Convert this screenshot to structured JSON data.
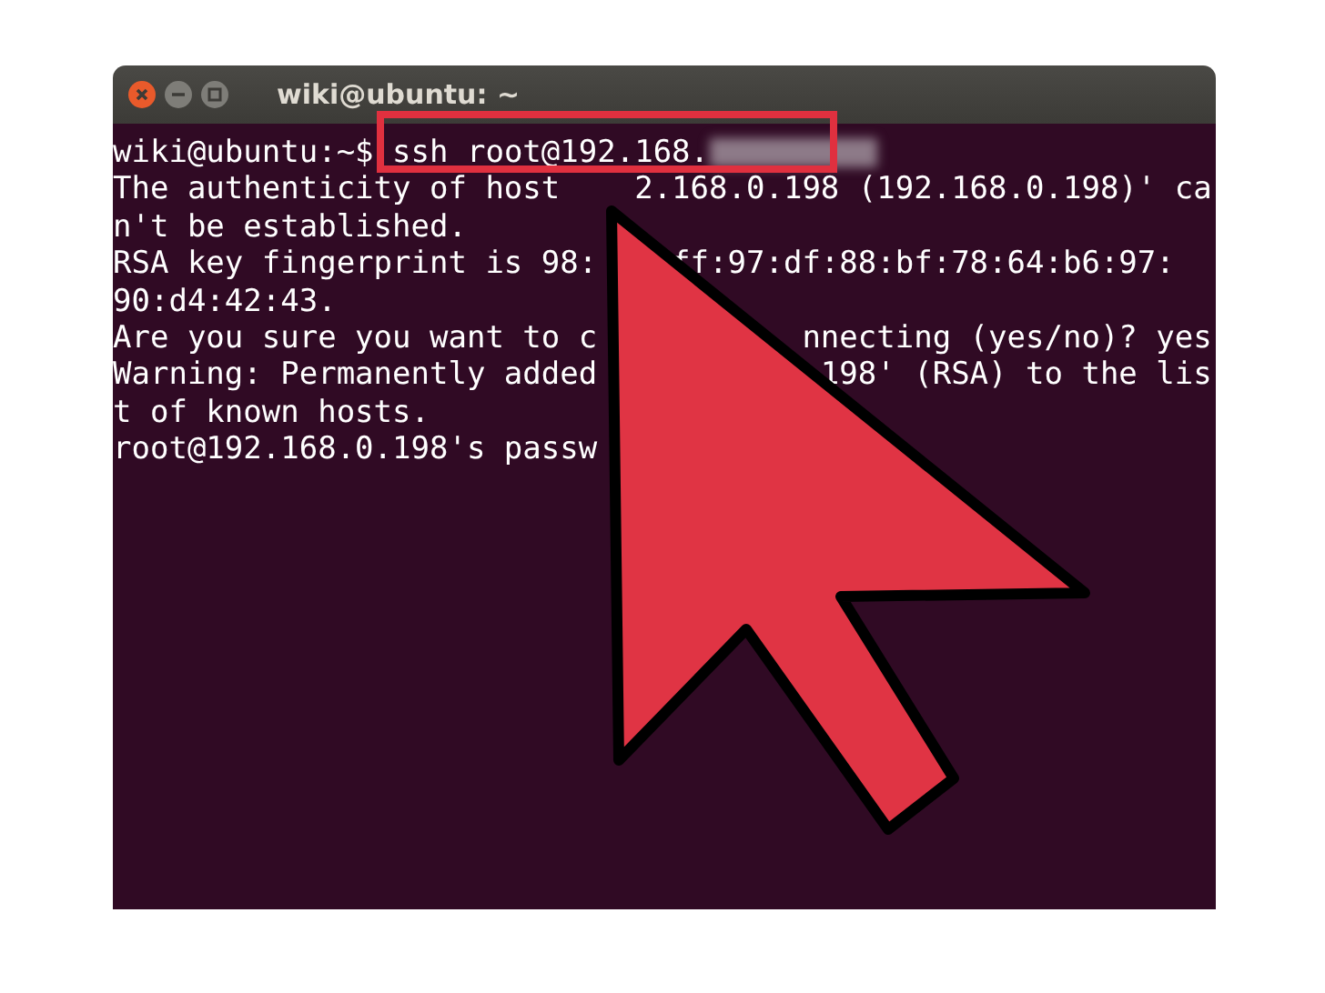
{
  "window": {
    "title": "wiki@ubuntu: ~"
  },
  "terminal": {
    "command_line": {
      "prompt": "wiki@ubuntu:~$",
      "command": "ssh root@192.168.",
      "redacted": true
    },
    "lines": [
      {
        "text": "The authenticity of host",
        "text_after_arrow": "2.168.0.198 (192.168.0.198)' ca"
      },
      {
        "text": "n't be established."
      },
      {
        "text": "RSA key fingerprint is 98:",
        "text_after_arrow": "ff:97:df:88:bf:78:64:b6:97:"
      },
      {
        "text": "90:d4:42:43."
      },
      {
        "text": "Are you sure you want to c",
        "text_after_arrow": "nnecting (yes/no)? yes"
      },
      {
        "text": "Warning: Permanently added",
        "text_after_arrow": "198' (RSA) to the lis"
      },
      {
        "text": "t of known hosts."
      },
      {
        "text": "root@192.168.0.198's passw"
      }
    ]
  }
}
